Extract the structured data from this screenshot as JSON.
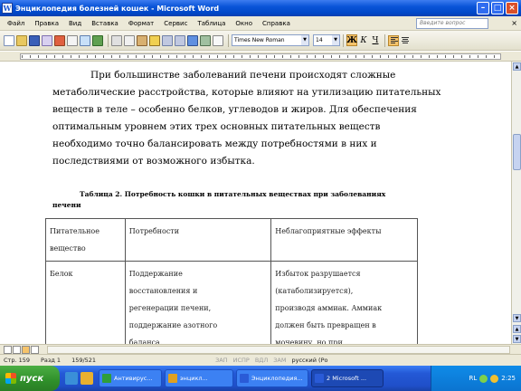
{
  "window": {
    "title": "Энциклопедия болезней кошек - Microsoft Word",
    "app_icon": "word-icon"
  },
  "menu": {
    "items": [
      "Файл",
      "Правка",
      "Вид",
      "Вставка",
      "Формат",
      "Сервис",
      "Таблица",
      "Окно",
      "Справка"
    ],
    "help_placeholder": "Введите вопрос"
  },
  "toolbar": {
    "font_name": "Times New Roman",
    "font_size": "14",
    "bold_label": "Ж",
    "italic_label": "К",
    "underline_label": "Ч",
    "bold_active": true,
    "align_left_active": true
  },
  "document": {
    "paragraph_lines": [
      "При большинстве заболеваний печени происходят сложные",
      "метаболические расстройства, которые влияют на утилизацию питательных",
      "веществ в теле – особенно белков, углеводов и жиров. Для обеспечения",
      "оптимальным уровнем этих трех основных питательных веществ",
      "необходимо точно балансировать между потребностями в них и",
      "последствиями от возможного избытка."
    ],
    "table_caption": [
      "Таблица 2. Потребность кошки в питательных веществах при заболеваниях",
      "печени"
    ],
    "table": {
      "headers": [
        [
          "Питательное",
          "вещество"
        ],
        [
          "Потребности"
        ],
        [
          "Неблагоприятные эффекты"
        ]
      ],
      "rows": [
        {
          "nutrient": [
            "Белок"
          ],
          "needs": [
            "Поддержание",
            "восстановления и",
            "регенерации печени,",
            "поддержание азотного",
            "баланса."
          ],
          "effects": [
            "Избыток разрушается",
            "(катаболизируется),",
            "производя аммиак. Аммиак",
            "должен быть превращен в",
            "мочевину, но при"
          ]
        }
      ]
    }
  },
  "statusbar": {
    "page": "Стр. 159",
    "section": "Разд 1",
    "pages": "159/521",
    "indicators": [
      "ЗАП",
      "ИСПР",
      "ВДЛ",
      "ЗАМ"
    ],
    "language": "русский (Ро"
  },
  "taskbar": {
    "start_label": "пуск",
    "tasks": [
      {
        "label": "Антивирус...",
        "icon_color": "#2f9e3a",
        "active": false
      },
      {
        "label": "энцикл...",
        "icon_color": "#e0a020",
        "active": false
      },
      {
        "label": "Энциклопедия...",
        "icon_color": "#2a5bd7",
        "active": false
      },
      {
        "label": "2 Microsoft ...",
        "icon_color": "#2a5bd7",
        "active": true
      }
    ],
    "tray_lang": "RL",
    "clock": "2:25"
  },
  "colors": {
    "titlebar": "#0a55d8",
    "taskbar": "#2459d6",
    "start": "#2f8f2a",
    "active_button": "#f6c36a"
  }
}
